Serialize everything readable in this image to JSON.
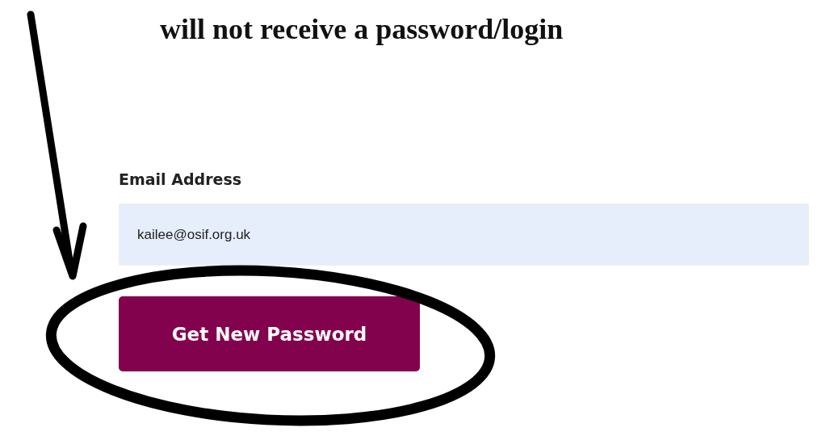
{
  "caption": "will not receive a password/login",
  "form": {
    "label": "Email Address",
    "email": "kailee@osif.org.uk",
    "button": "Get New Password"
  }
}
